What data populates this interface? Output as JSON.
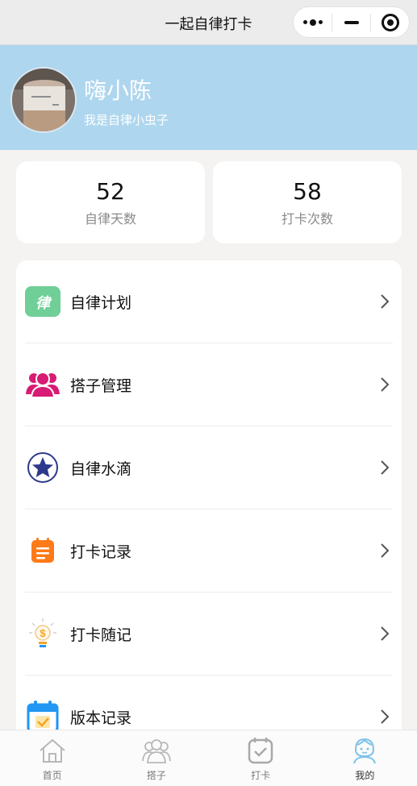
{
  "window": {
    "title": "一起自律打卡"
  },
  "profile": {
    "name": "嗨小陈",
    "motto": "我是自律小虫子"
  },
  "stats": [
    {
      "value": "52",
      "label": "自律天数"
    },
    {
      "value": "58",
      "label": "打卡次数"
    }
  ],
  "menu": [
    {
      "label": "自律计划",
      "icon": "discipline-badge-icon",
      "badge_text": "律",
      "color": "#6fcf97"
    },
    {
      "label": "搭子管理",
      "icon": "people-group-icon",
      "color": "#d81b74"
    },
    {
      "label": "自律水滴",
      "icon": "star-circle-icon",
      "color": "#2d3a8c"
    },
    {
      "label": "打卡记录",
      "icon": "clipboard-icon",
      "color": "#ff7a18"
    },
    {
      "label": "打卡随记",
      "icon": "lightbulb-dollar-icon",
      "color": "#f5a623"
    },
    {
      "label": "版本记录",
      "icon": "calendar-check-icon",
      "color": "#2196f3"
    }
  ],
  "tabbar": [
    {
      "label": "首页",
      "icon": "home-icon",
      "active": false
    },
    {
      "label": "搭子",
      "icon": "partners-icon",
      "active": false
    },
    {
      "label": "打卡",
      "icon": "checkin-calendar-icon",
      "active": false
    },
    {
      "label": "我的",
      "icon": "profile-face-icon",
      "active": true
    }
  ],
  "colors": {
    "header_bg": "#aed6ee",
    "active_tab": "#7ec3ea"
  }
}
